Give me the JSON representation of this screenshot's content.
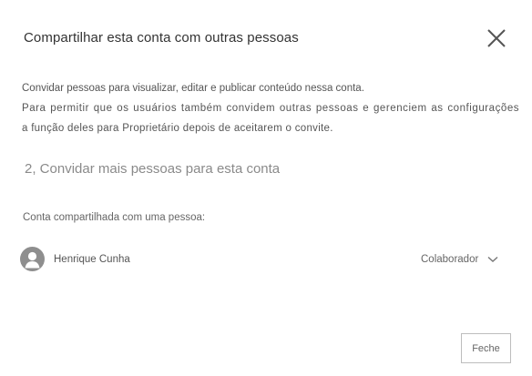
{
  "dialog": {
    "title": "Compartilhar esta conta com outras pessoas",
    "close_icon": "close-icon",
    "description": {
      "line1": "Convidar pessoas para visualizar, editar e publicar conteúdo nessa conta.",
      "line2": "Para permitir que os usuários também convidem outras pessoas e gerenciem as configurações",
      "line3": "a função deles para Proprietário depois de aceitarem o convite."
    },
    "invite_heading": "2, Convidar mais pessoas para esta conta",
    "shared_with_label": "Conta compartilhada com uma pessoa:",
    "people": [
      {
        "name": "Henrique Cunha",
        "avatar_icon": "person-icon",
        "role": "Colaborador",
        "role_icon": "chevron-down-icon"
      }
    ],
    "footer": {
      "close_label": "Feche"
    }
  },
  "colors": {
    "avatar_bg": "#8e8e8e",
    "heading_muted": "#8a8a8a",
    "button_border": "#bdbdbd"
  }
}
